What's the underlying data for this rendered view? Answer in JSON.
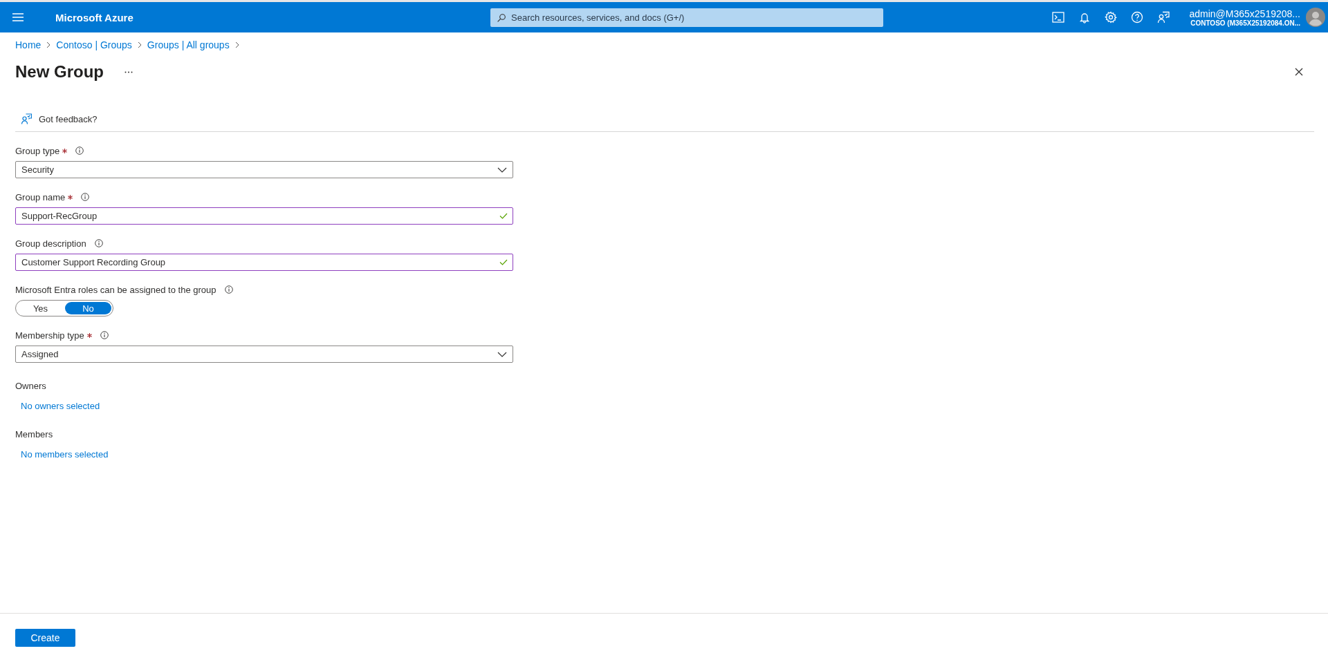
{
  "top_bar": {
    "brand": "Microsoft Azure",
    "search": {
      "placeholder": "Search resources, services, and docs (G+/)"
    },
    "account": {
      "user": "admin@M365x2519208...",
      "tenant": "CONTOSO (M365X25192084.ON..."
    }
  },
  "breadcrumb": [
    "Home",
    "Contoso | Groups",
    "Groups | All groups"
  ],
  "page": {
    "title": "New Group"
  },
  "toolbar": {
    "feedback": "Got feedback?"
  },
  "fields": [
    {
      "kind": "dropdown",
      "label": "Group type",
      "required": true,
      "value": "Security"
    },
    {
      "kind": "text",
      "label": "Group name",
      "required": true,
      "value": "Support-RecGroup",
      "valid": true
    },
    {
      "kind": "text",
      "label": "Group description",
      "required": false,
      "value": "Customer Support Recording Group",
      "valid": true
    },
    {
      "kind": "toggle",
      "label": "Microsoft Entra roles can be assigned to the group",
      "required": false,
      "options": [
        {
          "label": "Yes",
          "selected": false
        },
        {
          "label": "No",
          "selected": true
        }
      ]
    },
    {
      "kind": "dropdown",
      "label": "Membership type",
      "required": true,
      "value": "Assigned"
    }
  ],
  "pickers": [
    {
      "label": "Owners",
      "link": "No owners selected"
    },
    {
      "label": "Members",
      "link": "No members selected"
    }
  ],
  "footer": {
    "button": "Create"
  }
}
